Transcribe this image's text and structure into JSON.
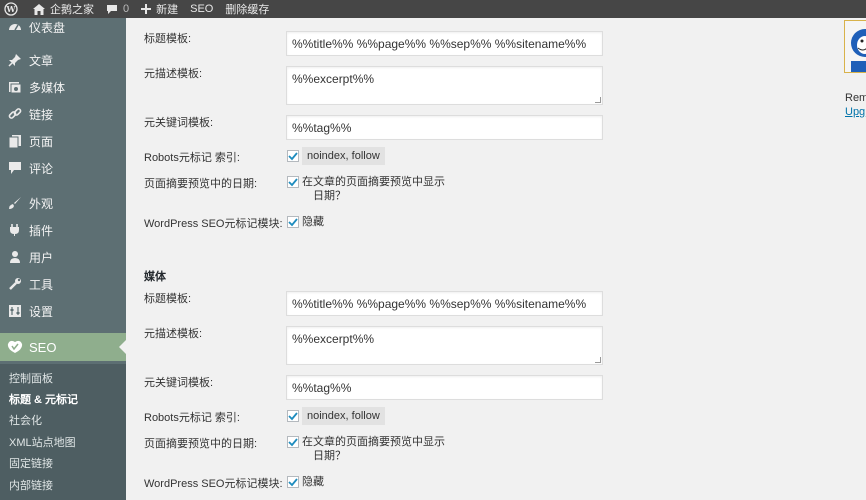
{
  "adminbar": {
    "site_name": "企鹅之家",
    "comments_count": "0",
    "new_label": "新建",
    "seo_label": "SEO",
    "clear_cache_label": "删除缓存"
  },
  "sidebar": {
    "items": [
      {
        "label": "仪表盘",
        "icon": "dashboard-icon"
      },
      {
        "label": "文章",
        "icon": "pin-icon"
      },
      {
        "label": "多媒体",
        "icon": "media-icon"
      },
      {
        "label": "链接",
        "icon": "link-icon"
      },
      {
        "label": "页面",
        "icon": "page-icon"
      },
      {
        "label": "评论",
        "icon": "comment-icon"
      },
      {
        "label": "外观",
        "icon": "brush-icon"
      },
      {
        "label": "插件",
        "icon": "plugin-icon"
      },
      {
        "label": "用户",
        "icon": "user-icon"
      },
      {
        "label": "工具",
        "icon": "wrench-icon"
      },
      {
        "label": "设置",
        "icon": "settings-icon"
      },
      {
        "label": "SEO",
        "icon": "seo-icon"
      }
    ],
    "submenu": [
      {
        "label": "控制面板"
      },
      {
        "label": "标题 & 元标记"
      },
      {
        "label": "社会化"
      },
      {
        "label": "XML站点地图"
      },
      {
        "label": "固定链接"
      },
      {
        "label": "内部链接"
      }
    ]
  },
  "section1": {
    "title_label": "标题模板:",
    "title_value": "%%title%% %%page%% %%sep%% %%sitename%%",
    "desc_label": "元描述模板:",
    "desc_value": "%%excerpt%%",
    "keywords_label": "元关键词模板:",
    "keywords_value": "%%tag%%",
    "robots_label": "Robots元标记 索引:",
    "robots_value": "noindex, follow",
    "date_label": "页面摘要预览中的日期:",
    "date_value_line1": "在文章的页面摘要预览中显示",
    "date_value_line2": "日期？",
    "metabox_label": "WordPress SEO元标记模块:",
    "metabox_value": "隐藏"
  },
  "section2": {
    "heading": "媒体",
    "title_label": "标题模板:",
    "title_value": "%%title%% %%page%% %%sep%% %%sitename%%",
    "desc_label": "元描述模板:",
    "desc_value": "%%excerpt%%",
    "keywords_label": "元关键词模板:",
    "keywords_value": "%%tag%%",
    "robots_label": "Robots元标记 索引:",
    "robots_value": "noindex, follow",
    "date_label": "页面摘要预览中的日期:",
    "date_value_line1": "在文章的页面摘要预览中显示",
    "date_value_line2": "日期？",
    "metabox_label": "WordPress SEO元标记模块:",
    "metabox_value": "隐藏"
  },
  "right_widget": {
    "text1": "Rem",
    "link": "Upg"
  },
  "colors": {
    "adminbar_bg": "#464646",
    "sidebar_bg": "#5d6f73",
    "current_menu_bg": "#8fae8d",
    "link": "#0073aa"
  }
}
